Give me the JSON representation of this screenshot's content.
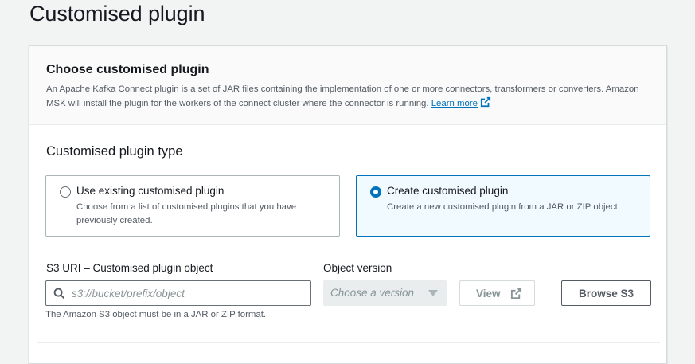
{
  "page": {
    "title": "Customised plugin"
  },
  "section": {
    "heading": "Choose customised plugin",
    "description": "An Apache Kafka Connect plugin is a set of JAR files containing the implementation of one or more connectors, transformers or converters. Amazon MSK will install the plugin for the workers of the connect cluster where the connector is running.",
    "learn_more": "Learn more"
  },
  "plugin_type": {
    "label": "Customised plugin type",
    "options": [
      {
        "title": "Use existing customised plugin",
        "description": "Choose from a list of customised plugins that you have previously created.",
        "selected": false
      },
      {
        "title": "Create customised plugin",
        "description": "Create a new customised plugin from a JAR or ZIP object.",
        "selected": true
      }
    ]
  },
  "s3": {
    "label": "S3 URI – Customised plugin object",
    "placeholder": "s3://bucket/prefix/object",
    "value": "",
    "hint": "The Amazon S3 object must be in a JAR or ZIP format."
  },
  "version": {
    "label": "Object version",
    "placeholder": "Choose a version"
  },
  "buttons": {
    "view": "View",
    "browse": "Browse S3"
  },
  "colors": {
    "accent": "#0073bb",
    "selected_bg": "#f1faff"
  },
  "icons": [
    "external-link-icon",
    "search-icon",
    "caret-down-icon"
  ]
}
